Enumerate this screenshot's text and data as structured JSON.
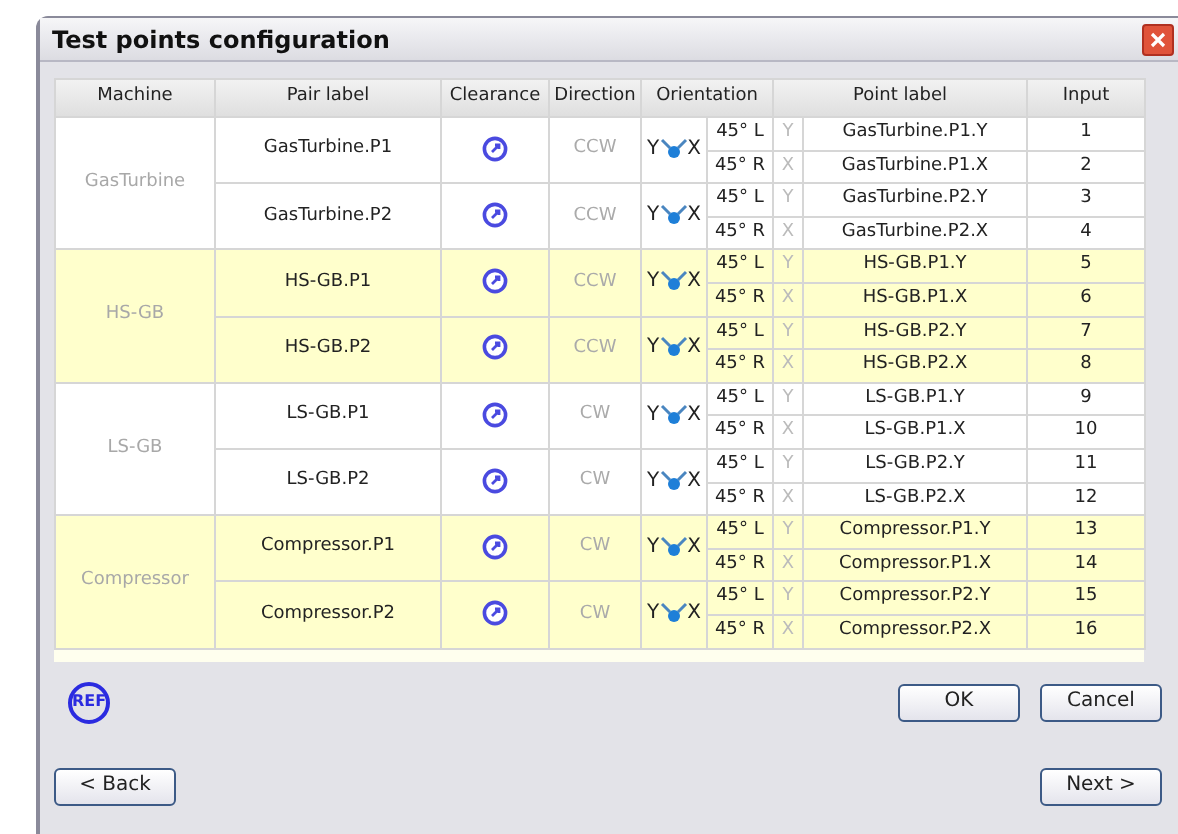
{
  "window": {
    "title": "Test points configuration"
  },
  "table": {
    "columns": [
      "Machine",
      "Pair label",
      "Clearance",
      "Direction",
      "Orientation",
      "Point label",
      "Input"
    ],
    "machines": [
      {
        "name": "GasTurbine",
        "highlighted": false,
        "pairs": [
          {
            "label": "GasTurbine.P1",
            "direction": "CCW",
            "orientation": {
              "left": "Y",
              "right": "X"
            },
            "points": [
              {
                "angle": "45° L",
                "axis": "Y",
                "label": "GasTurbine.P1.Y",
                "input": "1"
              },
              {
                "angle": "45° R",
                "axis": "X",
                "label": "GasTurbine.P1.X",
                "input": "2"
              }
            ]
          },
          {
            "label": "GasTurbine.P2",
            "direction": "CCW",
            "orientation": {
              "left": "Y",
              "right": "X"
            },
            "points": [
              {
                "angle": "45° L",
                "axis": "Y",
                "label": "GasTurbine.P2.Y",
                "input": "3"
              },
              {
                "angle": "45° R",
                "axis": "X",
                "label": "GasTurbine.P2.X",
                "input": "4"
              }
            ]
          }
        ]
      },
      {
        "name": "HS-GB",
        "highlighted": true,
        "pairs": [
          {
            "label": "HS-GB.P1",
            "direction": "CCW",
            "orientation": {
              "left": "Y",
              "right": "X"
            },
            "points": [
              {
                "angle": "45° L",
                "axis": "Y",
                "label": "HS-GB.P1.Y",
                "input": "5"
              },
              {
                "angle": "45° R",
                "axis": "X",
                "label": "HS-GB.P1.X",
                "input": "6"
              }
            ]
          },
          {
            "label": "HS-GB.P2",
            "direction": "CCW",
            "orientation": {
              "left": "Y",
              "right": "X"
            },
            "points": [
              {
                "angle": "45° L",
                "axis": "Y",
                "label": "HS-GB.P2.Y",
                "input": "7"
              },
              {
                "angle": "45° R",
                "axis": "X",
                "label": "HS-GB.P2.X",
                "input": "8"
              }
            ]
          }
        ]
      },
      {
        "name": "LS-GB",
        "highlighted": false,
        "pairs": [
          {
            "label": "LS-GB.P1",
            "direction": "CW",
            "orientation": {
              "left": "Y",
              "right": "X"
            },
            "points": [
              {
                "angle": "45° L",
                "axis": "Y",
                "label": "LS-GB.P1.Y",
                "input": "9"
              },
              {
                "angle": "45° R",
                "axis": "X",
                "label": "LS-GB.P1.X",
                "input": "10"
              }
            ]
          },
          {
            "label": "LS-GB.P2",
            "direction": "CW",
            "orientation": {
              "left": "Y",
              "right": "X"
            },
            "points": [
              {
                "angle": "45° L",
                "axis": "Y",
                "label": "LS-GB.P2.Y",
                "input": "11"
              },
              {
                "angle": "45° R",
                "axis": "X",
                "label": "LS-GB.P2.X",
                "input": "12"
              }
            ]
          }
        ]
      },
      {
        "name": "Compressor",
        "highlighted": true,
        "pairs": [
          {
            "label": "Compressor.P1",
            "direction": "CW",
            "orientation": {
              "left": "Y",
              "right": "X"
            },
            "points": [
              {
                "angle": "45° L",
                "axis": "Y",
                "label": "Compressor.P1.Y",
                "input": "13"
              },
              {
                "angle": "45° R",
                "axis": "X",
                "label": "Compressor.P1.X",
                "input": "14"
              }
            ]
          },
          {
            "label": "Compressor.P2",
            "direction": "CW",
            "orientation": {
              "left": "Y",
              "right": "X"
            },
            "points": [
              {
                "angle": "45° L",
                "axis": "Y",
                "label": "Compressor.P2.Y",
                "input": "15"
              },
              {
                "angle": "45° R",
                "axis": "X",
                "label": "Compressor.P2.X",
                "input": "16"
              }
            ]
          }
        ]
      }
    ]
  },
  "ref_badge": "REF",
  "buttons": {
    "ok": "OK",
    "cancel": "Cancel",
    "back": "< Back",
    "next": "Next >"
  }
}
